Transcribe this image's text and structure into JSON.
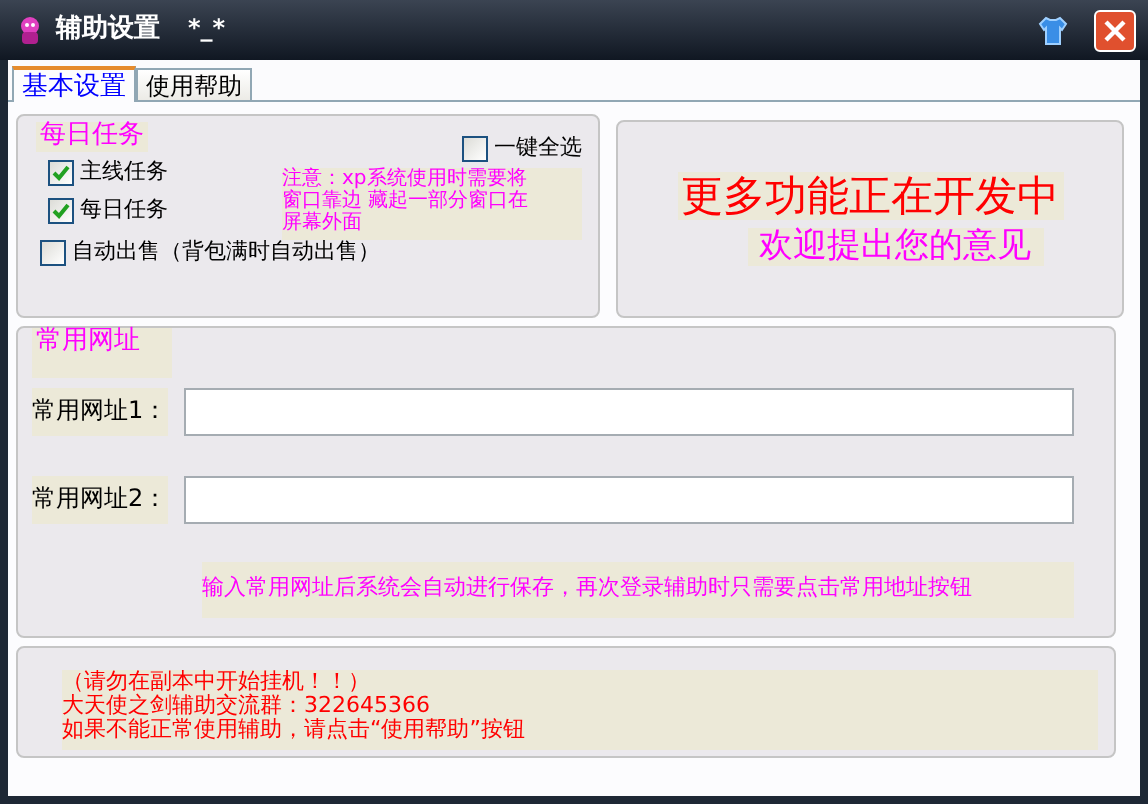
{
  "window": {
    "title": "辅助设置",
    "title_suffix": "*_*"
  },
  "tabs": [
    {
      "label": "基本设置",
      "selected": true
    },
    {
      "label": "使用帮助",
      "selected": false
    }
  ],
  "daily_tasks": {
    "title": "每日任务",
    "select_all": {
      "label": "一键全选",
      "checked": false
    },
    "tasks": [
      {
        "label": "主线任务",
        "checked": true
      },
      {
        "label": "每日任务",
        "checked": true
      },
      {
        "label": "自动出售（背包满时自动出售）",
        "checked": false
      }
    ],
    "note_lines": [
      "注意：xp系统使用时需要将",
      "窗口靠边 藏起一部分窗口在",
      "屏幕外面"
    ]
  },
  "promo": {
    "headline": "更多功能正在开发中",
    "subline": "欢迎提出您的意见"
  },
  "urls": {
    "title": "常用网址",
    "fields": [
      {
        "label": "常用网址1："
      },
      {
        "label": "常用网址2："
      }
    ],
    "hint": "输入常用网址后系统会自动进行保存，再次登录辅助时只需要点击常用地址按钮"
  },
  "notice_lines": [
    "（请勿在副本中开始挂机！！）",
    "大天使之剑辅助交流群：322645366",
    "如果不能正常使用辅助，请点击“使用帮助”按钮"
  ]
}
